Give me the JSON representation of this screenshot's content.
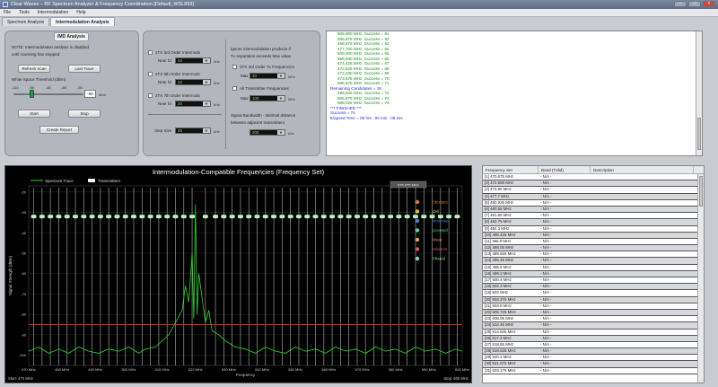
{
  "window": {
    "title": "Clear Waves – RF Spectrum Analyzer & Frequency Coordination [Default_WSL893]"
  },
  "menu": [
    "File",
    "Tools",
    "Intermodulation",
    "Help"
  ],
  "tabs": [
    "Spectrum Analysis",
    "Intermodulation Analysis"
  ],
  "imd": {
    "group_label": "IMD Analysis",
    "notice_line1": "NOTE: Intermodulation analysis is disabled",
    "notice_line2": "until scanning has stopped.",
    "refresh_scan": "Refresh Scan",
    "last_trace": "Last Trace",
    "threshold_label": "White Space Threshold (dBm)",
    "slider_ticks": [
      "-110",
      "-95",
      "-80",
      "-65",
      "-50"
    ],
    "threshold_value": "-85",
    "threshold_unit": "dBm",
    "start": "Start",
    "stop": "Stop",
    "create_report": "Create Report"
  },
  "orders": {
    "third": {
      "label": "2TX 3rd Order Intermods",
      "near_label": "Near fd",
      "value": "40",
      "unit": "kHz"
    },
    "fifth": {
      "label": "2TX 5th Order Intermods",
      "near_label": "Near fd",
      "value": "40",
      "unit": "kHz"
    },
    "seventh": {
      "label": "2TX 7th Order Intermods",
      "near_label": "Near fd",
      "value": "20",
      "unit": "kHz"
    },
    "step": {
      "label": "Step Size",
      "value": "25",
      "unit": "kHz"
    }
  },
  "ignore": {
    "line1": "Ignore intermodulation products if",
    "line2": "Tx separation exceeds Max value",
    "third_tx_label": "3TX 3rd Order Tx Frequencies",
    "third_max_label": "Max",
    "third_max_value": "40",
    "third_unit": "MHz",
    "all_tx_label": "All Transmitter Frequencies",
    "all_max_label": "Max",
    "all_max_value": "100",
    "all_unit": "MHz",
    "bandwidth_line1": "Signal Bandwidth - Minimal distance",
    "bandwidth_line2": "between adjacent transmitters",
    "bandwidth_value": "200",
    "bandwidth_unit": "kHz"
  },
  "log": {
    "lines": [
      {
        "text": "506,900 MHz, Success = 81",
        "cls": "green"
      },
      {
        "text": "586,875 MHz, Success = 82",
        "cls": "green"
      },
      {
        "text": "468,875 MHz, Success = 83",
        "cls": "green"
      },
      {
        "text": "477,700 MHz, Success = 64",
        "cls": "green"
      },
      {
        "text": "509,000 MHz, Success = 65",
        "cls": "green"
      },
      {
        "text": "558,000 MHz, Success = 66",
        "cls": "green"
      },
      {
        "text": "574,425 MHz, Success = 67",
        "cls": "green"
      },
      {
        "text": "473,625 MHz, Success = 68",
        "cls": "green"
      },
      {
        "text": "473,200 MHz, Success = 69",
        "cls": "green"
      },
      {
        "text": "473,675 MHz, Success = 70",
        "cls": "green"
      },
      {
        "text": "595,675 MHz, Success = 71",
        "cls": "green"
      },
      {
        "text": "Remaining Candidates = 18",
        "cls": ""
      },
      {
        "text": "486,825 MHz, Success = 72",
        "cls": "green"
      },
      {
        "text": "506,875 MHz, Success = 73",
        "cls": "green"
      },
      {
        "text": "598,025 MHz, Success = 74",
        "cls": "green"
      },
      {
        "text": "",
        "cls": ""
      },
      {
        "text": "*** FINISHED ***",
        "cls": "blue"
      },
      {
        "text": "Success = 74",
        "cls": "blue"
      },
      {
        "text": "Elapsed Time = 00 hrs : 00 min : 08 sec",
        "cls": "blue"
      }
    ]
  },
  "chart_data": {
    "type": "line",
    "title": "Intermodulation-Compatible Frequencies (Frequency Set)",
    "legend": [
      "Spectrum Trace",
      "Transmitters"
    ],
    "marker_box": "545.875 MHz",
    "ylabel": "Signal Strength (dBm)",
    "xlabel": "Frequency",
    "x_ticks": [
      "470 MHz",
      "480 MHz",
      "490 MHz",
      "500 MHz",
      "510 MHz",
      "520 MHz",
      "530 MHz",
      "540 MHz",
      "550 MHz",
      "560 MHz",
      "570 MHz",
      "580 MHz",
      "590 MHz",
      "600 MHz"
    ],
    "y_ticks": [
      "-20",
      "-30",
      "-40",
      "-50",
      "-60",
      "-70",
      "-80",
      "-90",
      "-100"
    ],
    "xlim": [
      470,
      600
    ],
    "ylim": [
      -105,
      -17
    ],
    "threshold_dbm": -85,
    "transmitter_level_dbm": -32,
    "footer_start": "Start: 470 MHz",
    "footer_stop": "Stop: 600 MHz",
    "legend_entries": [
      {
        "name": "Structure",
        "color": "#e07a2a"
      },
      {
        "name": "Cell",
        "color": "#e0c030"
      },
      {
        "name": "Moderate",
        "color": "#4a80c8"
      },
      {
        "name": "Licensed",
        "color": "#6ad08a"
      },
      {
        "name": "Weak",
        "color": "#e0a040"
      },
      {
        "name": "Wireless",
        "color": "#e05050"
      },
      {
        "name": "Filtered",
        "color": "#7ae0a0"
      }
    ],
    "spectrum": [
      [
        470,
        -98
      ],
      [
        473,
        -96
      ],
      [
        476,
        -99
      ],
      [
        479,
        -97
      ],
      [
        482,
        -99
      ],
      [
        485,
        -96
      ],
      [
        488,
        -98
      ],
      [
        491,
        -99
      ],
      [
        494,
        -97
      ],
      [
        497,
        -98
      ],
      [
        500,
        -96
      ],
      [
        503,
        -99
      ],
      [
        505,
        -97
      ],
      [
        508,
        -96
      ],
      [
        510,
        -93
      ],
      [
        512,
        -90
      ],
      [
        514,
        -84
      ],
      [
        516,
        -78
      ],
      [
        517,
        -66
      ],
      [
        518,
        -74
      ],
      [
        519,
        -50
      ],
      [
        519.5,
        -82
      ],
      [
        520,
        -26
      ],
      [
        520.5,
        -80
      ],
      [
        521,
        -60
      ],
      [
        522,
        -72
      ],
      [
        523,
        -84
      ],
      [
        524,
        -78
      ],
      [
        525,
        -88
      ],
      [
        527,
        -90
      ],
      [
        529,
        -93
      ],
      [
        532,
        -96
      ],
      [
        535,
        -97
      ],
      [
        538,
        -99
      ],
      [
        541,
        -96
      ],
      [
        544,
        -98
      ],
      [
        547,
        -99
      ],
      [
        550,
        -96
      ],
      [
        553,
        -98
      ],
      [
        556,
        -97
      ],
      [
        559,
        -99
      ],
      [
        562,
        -96
      ],
      [
        565,
        -98
      ],
      [
        568,
        -97
      ],
      [
        571,
        -99
      ],
      [
        574,
        -96
      ],
      [
        577,
        -98
      ],
      [
        580,
        -97
      ],
      [
        583,
        -99
      ],
      [
        586,
        -96
      ],
      [
        589,
        -98
      ],
      [
        592,
        -97
      ],
      [
        595,
        -99
      ],
      [
        598,
        -97
      ],
      [
        600,
        -98
      ]
    ],
    "transmitters": [
      471.5,
      474,
      476.5,
      479,
      481.5,
      484,
      486.5,
      489,
      491.5,
      494,
      496.5,
      499,
      501.5,
      504,
      506.5,
      509,
      511.5,
      514,
      516.5,
      519,
      523,
      526,
      528.5,
      531,
      533.5,
      536,
      538.5,
      541,
      543.5,
      546,
      548.5,
      551,
      553.5,
      556,
      558.5,
      561,
      563.5,
      566,
      568.5,
      571,
      573.5,
      576,
      578.5,
      581,
      583.5,
      586,
      588.5,
      591,
      593.5,
      596,
      598.5
    ]
  },
  "freq_table": {
    "headers": [
      "Frequency Set",
      "Band (Tvlid)",
      "Description"
    ],
    "rows": [
      [
        "[1] 470.675 MHz",
        "- N/A -"
      ],
      [
        "[2] 472.925 MHz",
        "- N/A -"
      ],
      [
        "[3] 473.95 MHz",
        "- N/A -"
      ],
      [
        "[4] 477.7 MHz",
        "- N/A -"
      ],
      [
        "[5] 480.925 MHz",
        "- N/A -"
      ],
      [
        "[6] 480.55 MHz",
        "- N/A -"
      ],
      [
        "[7] 481.65 MHz",
        "- N/A -"
      ],
      [
        "[8] 482.75 MHz",
        "- N/A -"
      ],
      [
        "[9] 484.3 MHz",
        "- N/A -"
      ],
      [
        "[10] 486.425 MHz",
        "- N/A -"
      ],
      [
        "[11] 486.9 MHz",
        "- N/A -"
      ],
      [
        "[12] 488.05 MHz",
        "- N/A -"
      ],
      [
        "[13] 489.925 MHz",
        "- N/A -"
      ],
      [
        "[14] 495.45 MHz",
        "- N/A -"
      ],
      [
        "[15] 495.6 MHz",
        "- N/A -"
      ],
      [
        "[16] 499.2 MHz",
        "- N/A -"
      ],
      [
        "[17] 500.4 MHz",
        "- N/A -"
      ],
      [
        "[18] 502.3 MHz",
        "- N/A -"
      ],
      [
        "[19] 503 MHz",
        "- N/A -"
      ],
      [
        "[20] 503.375 MHz",
        "- N/A -"
      ],
      [
        "[21] 504.8 MHz",
        "- N/A -"
      ],
      [
        "[22] 505.725 MHz",
        "- N/A -"
      ],
      [
        "[23] 508.05 MHz",
        "- N/A -"
      ],
      [
        "[24] 512.45 MHz",
        "- N/A -"
      ],
      [
        "[25] 514.625 MHz",
        "- N/A -"
      ],
      [
        "[26] 517.3 MHz",
        "- N/A -"
      ],
      [
        "[27] 518.55 MHz",
        "- N/A -"
      ],
      [
        "[28] 519.625 MHz",
        "- N/A -"
      ],
      [
        "[29] 520.2 MHz",
        "- N/A -"
      ],
      [
        "[30] 521.675 MHz",
        "- N/A -"
      ],
      [
        "[31] 523.175 MHz",
        "- N/A -"
      ]
    ]
  }
}
